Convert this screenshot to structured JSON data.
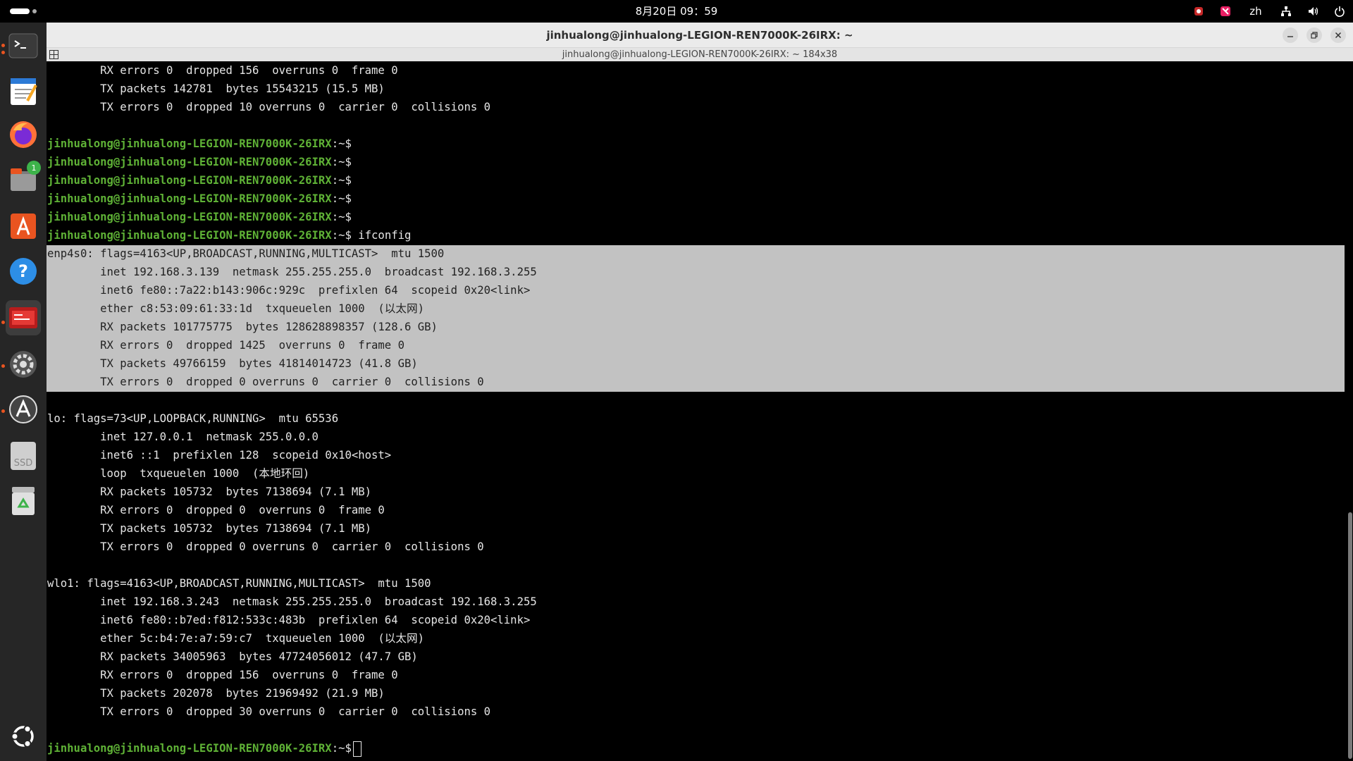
{
  "topbar": {
    "clock": "8月20日  09：59",
    "lang": "zh",
    "icons": [
      "recorder-icon",
      "app-indicator-icon",
      "network-icon",
      "volume-icon",
      "power-icon"
    ]
  },
  "dock": {
    "items": [
      "terminal",
      "text-editor",
      "firefox",
      "files",
      "app-center",
      "help",
      "screenshot-app",
      "settings",
      "software-updater",
      "ssd-drive",
      "trash",
      "show-apps"
    ],
    "files_badge": "1",
    "ssd_label": "SSD"
  },
  "window": {
    "title": "jinhualong@jinhualong-LEGION-REN7000K-26IRX: ~",
    "subtitle": "jinhualong@jinhualong-LEGION-REN7000K-26IRX: ~ 184x38"
  },
  "terminal": {
    "prompt": "jinhualong@jinhualong-LEGION-REN7000K-26IRX",
    "prompt_suffix": ":~$",
    "command": " ifconfig",
    "lines_top": [
      "        RX errors 0  dropped 156  overruns 0  frame 0",
      "        TX packets 142781  bytes 15543215 (15.5 MB)",
      "        TX errors 0  dropped 10 overruns 0  carrier 0  collisions 0"
    ],
    "enp4s0": [
      "enp4s0: flags=4163<UP,BROADCAST,RUNNING,MULTICAST>  mtu 1500",
      "        inet 192.168.3.139  netmask 255.255.255.0  broadcast 192.168.3.255",
      "        inet6 fe80::7a22:b143:906c:929c  prefixlen 64  scopeid 0x20<link>",
      "        ether c8:53:09:61:33:1d  txqueuelen 1000  (以太网)",
      "        RX packets 101775775  bytes 128628898357 (128.6 GB)",
      "        RX errors 0  dropped 1425  overruns 0  frame 0",
      "        TX packets 49766159  bytes 41814014723 (41.8 GB)",
      "        TX errors 0  dropped 0 overruns 0  carrier 0  collisions 0"
    ],
    "lo": [
      "lo: flags=73<UP,LOOPBACK,RUNNING>  mtu 65536",
      "        inet 127.0.0.1  netmask 255.0.0.0",
      "        inet6 ::1  prefixlen 128  scopeid 0x10<host>",
      "        loop  txqueuelen 1000  (本地环回)",
      "        RX packets 105732  bytes 7138694 (7.1 MB)",
      "        RX errors 0  dropped 0  overruns 0  frame 0",
      "        TX packets 105732  bytes 7138694 (7.1 MB)",
      "        TX errors 0  dropped 0 overruns 0  carrier 0  collisions 0"
    ],
    "wlo1": [
      "wlo1: flags=4163<UP,BROADCAST,RUNNING,MULTICAST>  mtu 1500",
      "        inet 192.168.3.243  netmask 255.255.255.0  broadcast 192.168.3.255",
      "        inet6 fe80::b7ed:f812:533c:483b  prefixlen 64  scopeid 0x20<link>",
      "        ether 5c:b4:7e:a7:59:c7  txqueuelen 1000  (以太网)",
      "        RX packets 34005963  bytes 47724056012 (47.7 GB)",
      "        RX errors 0  dropped 156  overruns 0  frame 0",
      "        TX packets 202078  bytes 21969492 (21.9 MB)",
      "        TX errors 0  dropped 30 overruns 0  carrier 0  collisions 0"
    ]
  },
  "colors": {
    "prompt": "#5fb236",
    "selection": "#c2c2c2",
    "accent": "#e95420"
  }
}
